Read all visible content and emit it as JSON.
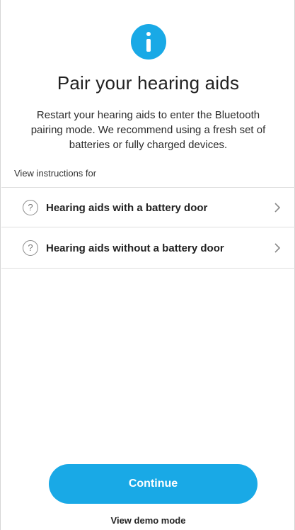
{
  "header": {
    "icon": "info-icon",
    "title": "Pair your hearing aids",
    "description": "Restart your hearing aids to enter the Bluetooth pairing mode. We recommend using a fresh set of batteries or fully charged devices."
  },
  "instructions": {
    "label": "View instructions for",
    "options": [
      {
        "label": "Hearing aids with a battery door",
        "icon": "question-circle-icon",
        "trailing_icon": "chevron-right-icon"
      },
      {
        "label": "Hearing aids without a battery door",
        "icon": "question-circle-icon",
        "trailing_icon": "chevron-right-icon"
      }
    ]
  },
  "footer": {
    "continue_label": "Continue",
    "demo_label": "View demo mode"
  },
  "colors": {
    "accent": "#19a9e6",
    "divider": "#dedede",
    "text": "#222222"
  }
}
